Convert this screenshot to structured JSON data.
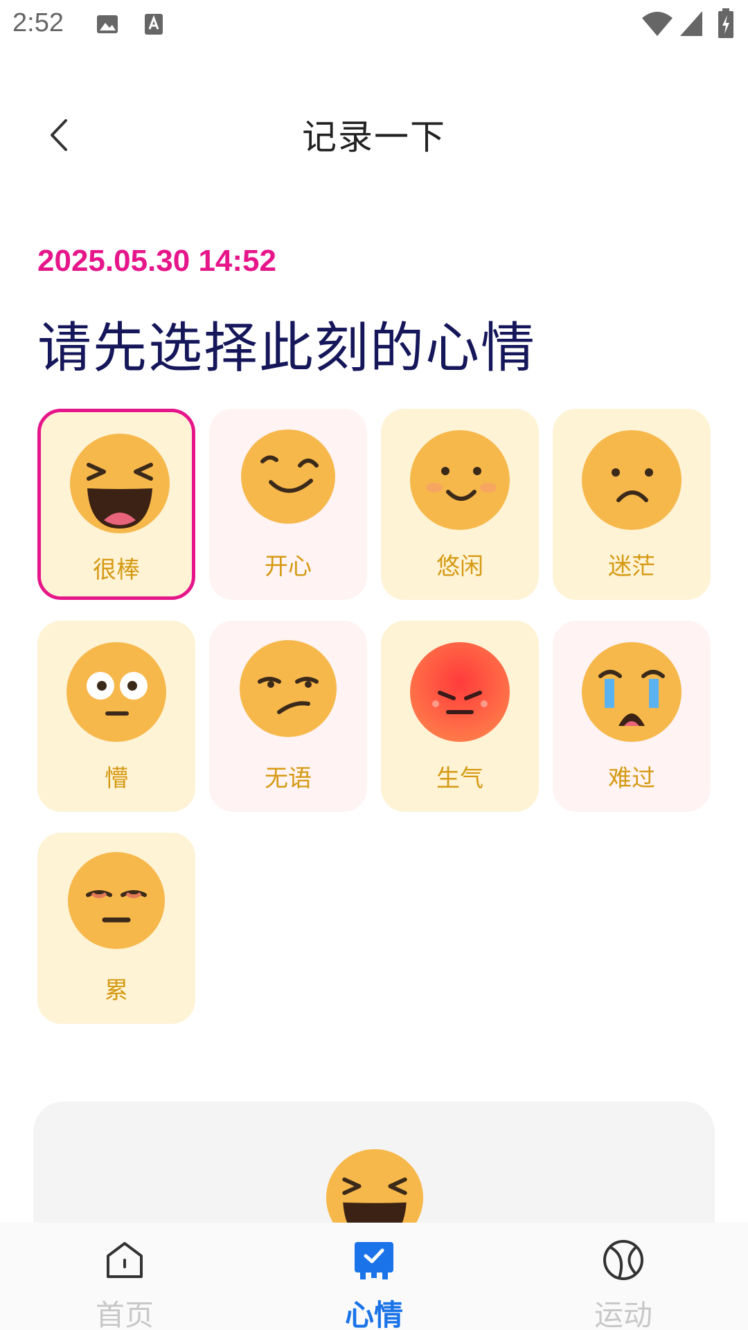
{
  "status_bar": {
    "time": "2:52",
    "icons": [
      "gallery-icon",
      "font-a-icon",
      "wifi-icon",
      "signal-icon",
      "battery-charging-icon"
    ]
  },
  "header": {
    "title": "记录一下",
    "back_icon": "chevron-left-icon"
  },
  "entry": {
    "datetime": "2025.05.30 14:52",
    "prompt": "请先选择此刻的心情"
  },
  "moods": [
    {
      "label": "很棒",
      "face": "laughing",
      "selected": true
    },
    {
      "label": "开心",
      "face": "wink"
    },
    {
      "label": "悠闲",
      "face": "smile"
    },
    {
      "label": "迷茫",
      "face": "frown"
    },
    {
      "label": "懵",
      "face": "wide-eyes"
    },
    {
      "label": "无语",
      "face": "unamused"
    },
    {
      "label": "生气",
      "face": "angry"
    },
    {
      "label": "难过",
      "face": "crying"
    },
    {
      "label": "累",
      "face": "tired"
    }
  ],
  "bottom_nav": {
    "items": [
      {
        "label": "首页",
        "icon": "home-icon"
      },
      {
        "label": "心情",
        "icon": "mood-calendar-icon",
        "active": true
      },
      {
        "label": "运动",
        "icon": "ball-icon"
      }
    ]
  },
  "colors": {
    "accent_pink": "#e6168a",
    "title_navy": "#15175a",
    "label_gold": "#d59a13",
    "nav_active": "#1a73e8",
    "card_warm": "#fff3d6",
    "card_pink": "#fff3f3"
  }
}
